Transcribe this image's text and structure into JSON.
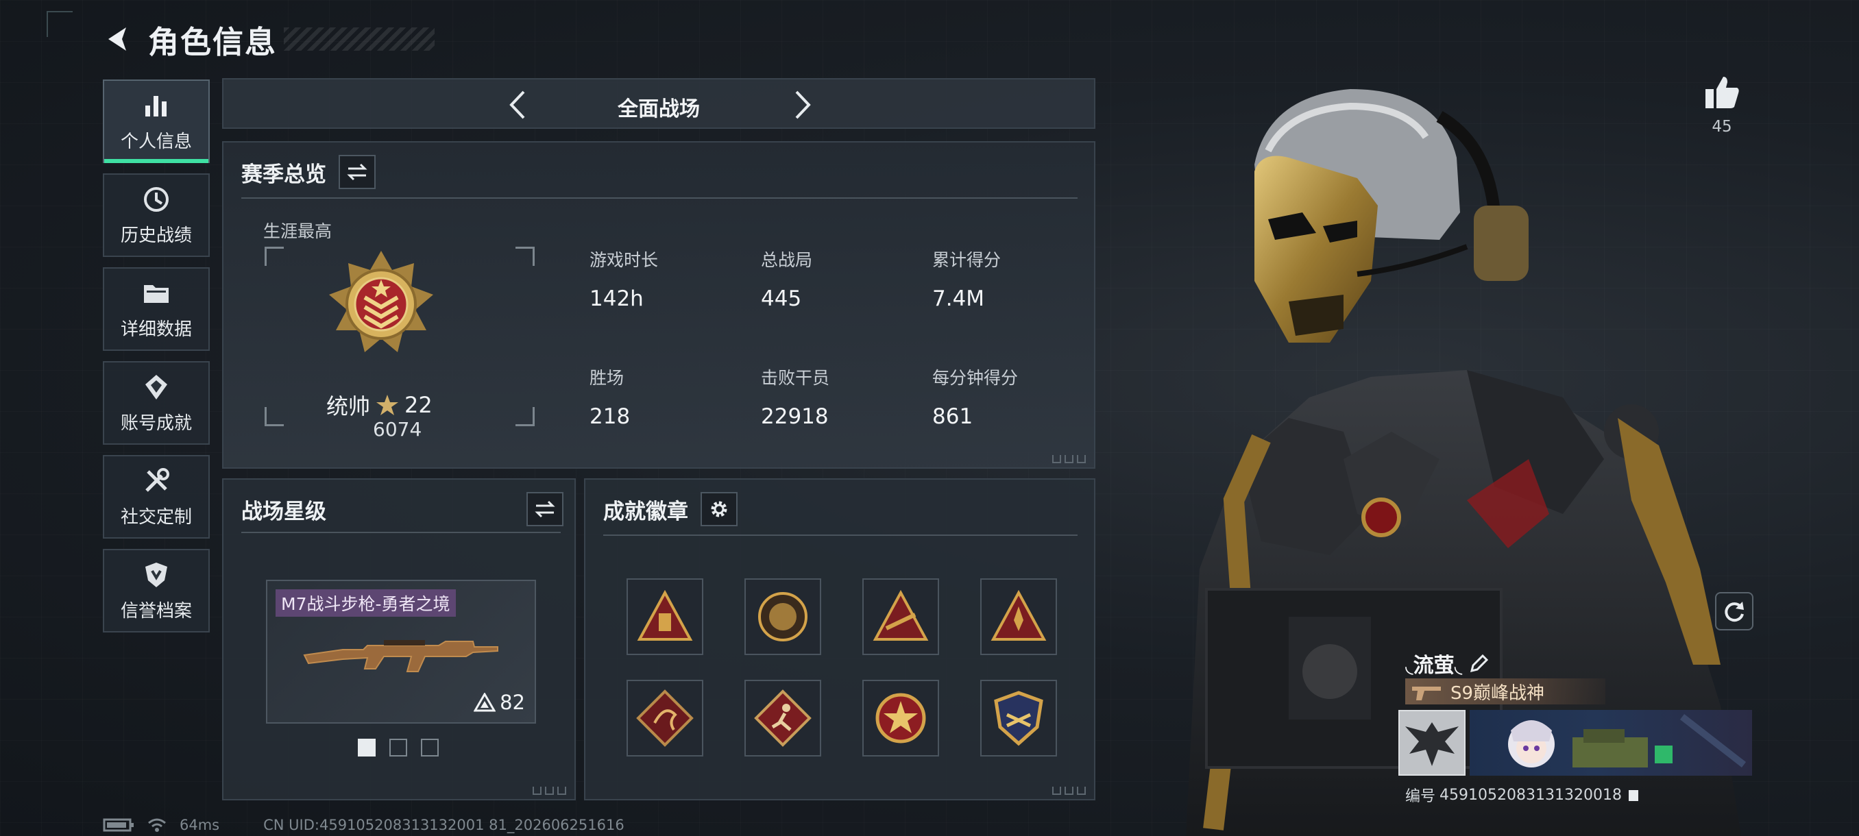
{
  "header": {
    "title": "角色信息"
  },
  "sidebar": {
    "items": [
      {
        "label": "个人信息",
        "active": true
      },
      {
        "label": "历史战绩"
      },
      {
        "label": "详细数据"
      },
      {
        "label": "账号成就"
      },
      {
        "label": "社交定制"
      },
      {
        "label": "信誉档案"
      }
    ]
  },
  "mode_tabs": {
    "current": "全面战场"
  },
  "season": {
    "title": "赛季总览",
    "career_label": "生涯最高",
    "rank": {
      "name": "统帅",
      "star_level": "22",
      "points": "6074"
    },
    "stats": [
      {
        "label": "游戏时长",
        "value": "142h"
      },
      {
        "label": "总战局",
        "value": "445"
      },
      {
        "label": "累计得分",
        "value": "7.4M"
      },
      {
        "label": "胜场",
        "value": "218"
      },
      {
        "label": "击败干员",
        "value": "22918"
      },
      {
        "label": "每分钟得分",
        "value": "861"
      }
    ]
  },
  "star_panel": {
    "title": "战场星级",
    "weapon": {
      "name": "M7战斗步枪-勇者之境",
      "level": "82"
    },
    "pages": 3,
    "current_page": 1
  },
  "badge_panel": {
    "title": "成就徽章",
    "badges": [
      "triangle-badge",
      "round-badge",
      "triangle-rifle-badge",
      "triangle-rocket-badge",
      "dragon-badge",
      "runner-badge",
      "star-crest-badge",
      "shield-crest-badge"
    ]
  },
  "likes": {
    "count": "45"
  },
  "player": {
    "name": "◟流萤◟",
    "tag": "S9巅峰战神",
    "id_label": "编号",
    "id": "4591052083131320018"
  },
  "status": {
    "ping": "64ms",
    "uid": "CN UID:459105208313132001 81_202606251616"
  },
  "colors": {
    "accent": "#3fe0a3",
    "gold": "#c9a24a",
    "red": "#b4262c",
    "panel": "#262d35"
  }
}
